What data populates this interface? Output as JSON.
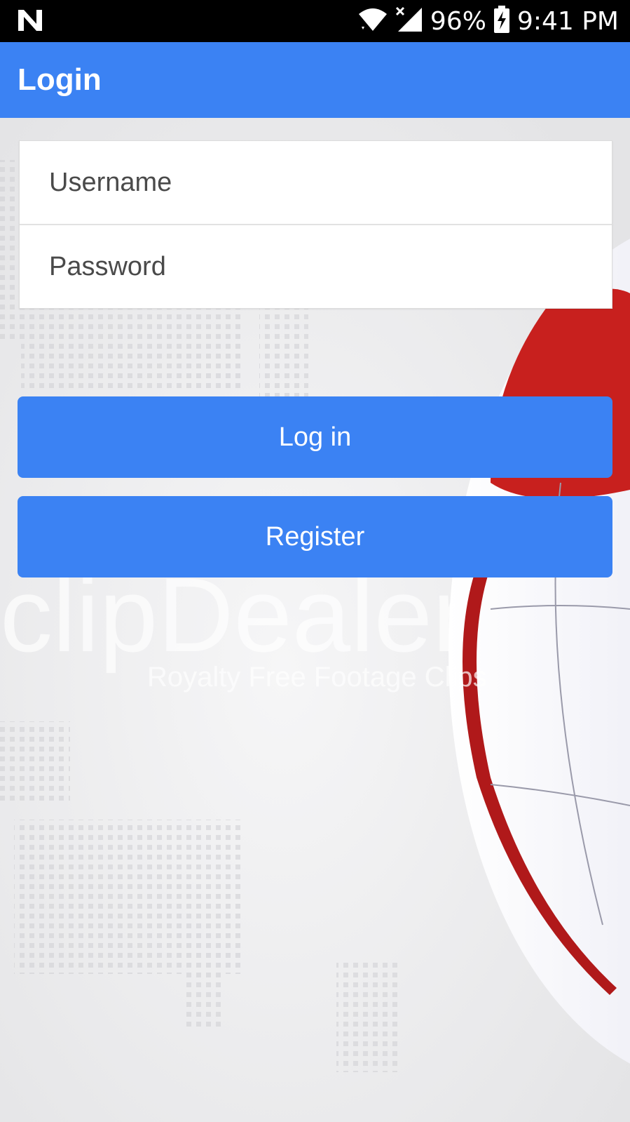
{
  "status_bar": {
    "notification_icon": "n-logo-icon",
    "wifi_icon": "wifi-icon",
    "signal_icon": "cell-signal-no-service-icon",
    "battery_percent": "96%",
    "battery_icon": "battery-charging-icon",
    "time": "9:41 PM"
  },
  "app_bar": {
    "title": "Login"
  },
  "form": {
    "username": {
      "placeholder": "Username",
      "value": ""
    },
    "password": {
      "placeholder": "Password",
      "value": ""
    }
  },
  "buttons": {
    "login_label": "Log in",
    "register_label": "Register"
  },
  "background": {
    "watermark_text": "clipDealer",
    "watermark_subtext": "Royalty Free Footage Clips"
  },
  "colors": {
    "primary": "#3b82f3",
    "status_bar": "#000000",
    "globe_red": "#c8201e"
  }
}
